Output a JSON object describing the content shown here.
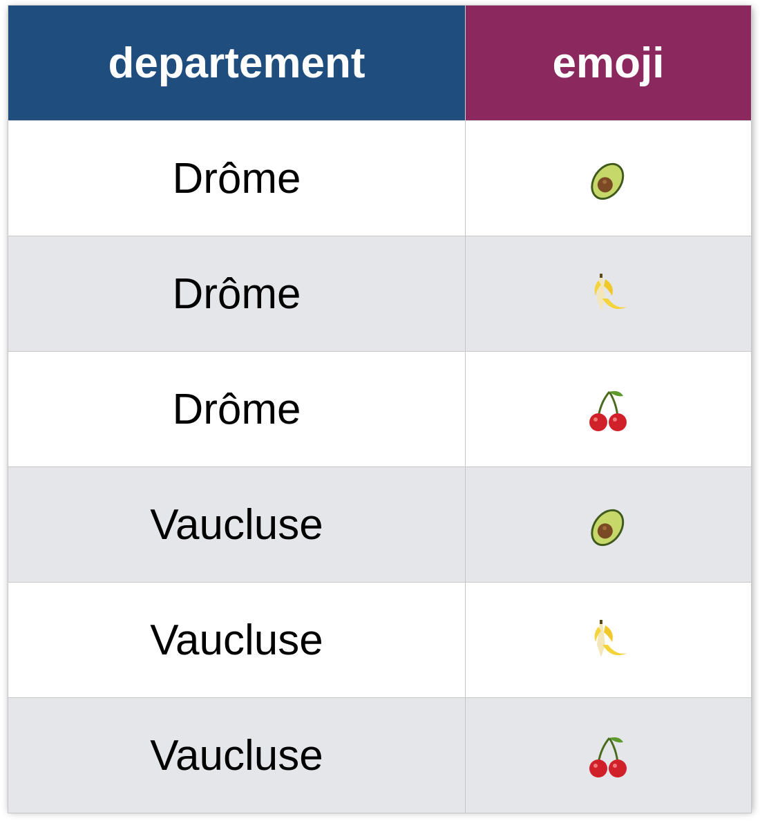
{
  "table": {
    "headers": [
      "departement",
      "emoji"
    ],
    "header_colors": [
      "#1f4e7e",
      "#8b285e"
    ],
    "rows": [
      {
        "departement": "Drôme",
        "emoji": "🥑",
        "icon": "avocado-icon"
      },
      {
        "departement": "Drôme",
        "emoji": "🍌",
        "icon": "banana-icon"
      },
      {
        "departement": "Drôme",
        "emoji": "🍒",
        "icon": "cherries-icon"
      },
      {
        "departement": "Vaucluse",
        "emoji": "🥑",
        "icon": "avocado-icon"
      },
      {
        "departement": "Vaucluse",
        "emoji": "🍌",
        "icon": "banana-icon"
      },
      {
        "departement": "Vaucluse",
        "emoji": "🍒",
        "icon": "cherries-icon"
      }
    ]
  }
}
